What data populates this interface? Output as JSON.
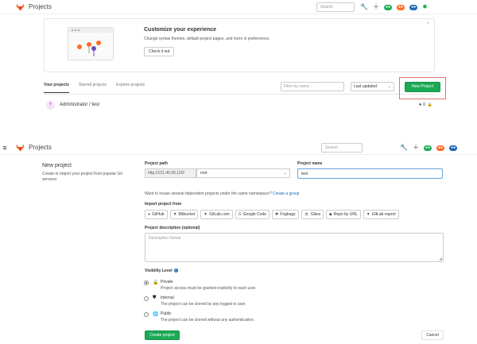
{
  "top_navbar": {
    "title": "Projects",
    "search_placeholder": "Search"
  },
  "banner": {
    "title": "Customize your experience",
    "subtitle": "Change syntax themes, default project pages, and more in preferences.",
    "button_label": "Check it out",
    "close_glyph": "×"
  },
  "tabs": {
    "your_projects": "Your projects",
    "starred_projects": "Starred projects",
    "explore_projects": "Explore projects"
  },
  "filters": {
    "filter_placeholder": "Filter by name...",
    "sort_value": "Last updated",
    "new_project_label": "New Project"
  },
  "project_row": {
    "avatar_letter": "T",
    "name": "Administrator / test",
    "star_glyph": "★",
    "star_count": "0",
    "lock_glyph": "🔒"
  },
  "bottom_navbar": {
    "title": "Projects",
    "search_placeholder": "Search"
  },
  "new_project": {
    "title": "New project",
    "subtitle": "Create or import your project from popular Git services",
    "path_label": "Project path",
    "path_prefix": "http://121.40.90.120/",
    "path_namespace": "root",
    "name_label": "Project name",
    "name_value": "test",
    "namespace_hint": "Want to house several dependent projects under the same namespace?",
    "namespace_link": "Create a group",
    "import_label": "Import project from",
    "import_sources": [
      "GitHub",
      "Bitbucket",
      "GitLab.com",
      "Google Code",
      "Fogbugz",
      "Gitea",
      "Repo by URL",
      "GitLab export"
    ],
    "description_label": "Project description (optional)",
    "description_placeholder": "Description format",
    "visibility_label": "Visibility Level",
    "visibility_options": [
      {
        "name": "Private",
        "desc": "Project access must be granted explicitly to each user.",
        "selected": true
      },
      {
        "name": "Internal",
        "desc": "The project can be cloned by any logged in user.",
        "selected": false
      },
      {
        "name": "Public",
        "desc": "The project can be cloned without any authentication.",
        "selected": false
      }
    ],
    "create_label": "Create project",
    "cancel_label": "Cancel"
  },
  "colors": {
    "primary_green": "#1aaa55",
    "link_blue": "#1b69b6",
    "highlight_red": "#e57373",
    "focus_blue": "#69a3dd"
  }
}
